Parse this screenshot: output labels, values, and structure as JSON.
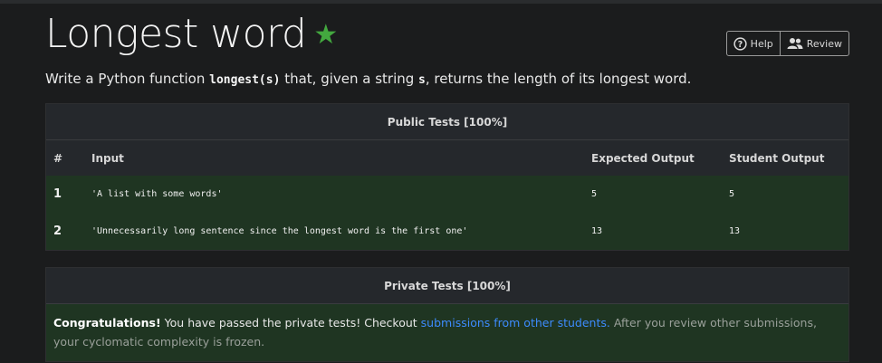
{
  "header": {
    "title": "Longest word",
    "star": "★",
    "help_label": "Help",
    "review_label": "Review"
  },
  "description": {
    "text1": "Write a Python function ",
    "code1": "longest(s)",
    "text2": " that, given a string ",
    "code2": "s",
    "text3": ", returns the length of its longest word."
  },
  "public_tests": {
    "title": "Public Tests [100%]",
    "columns": [
      "#",
      "Input",
      "Expected Output",
      "Student Output"
    ],
    "rows": [
      {
        "num": "1",
        "input": "'A list with some words'",
        "expected": "5",
        "student": "5"
      },
      {
        "num": "2",
        "input": "'Unnecessarily long sentence since the longest word is the first one'",
        "expected": "13",
        "student": "13"
      }
    ]
  },
  "private_tests": {
    "title": "Private Tests [100%]",
    "congrats": "Congratulations!",
    "text1": " You have passed the private tests! Checkout ",
    "link": "submissions from other students.",
    "muted": " After you review other submissions, your cyclomatic complexity is frozen."
  },
  "colors": {
    "background": "#1b1c1d",
    "card_success": "#1f3522",
    "header_bg": "#25282c",
    "star": "#43a83f",
    "link": "#3d8bfd"
  }
}
